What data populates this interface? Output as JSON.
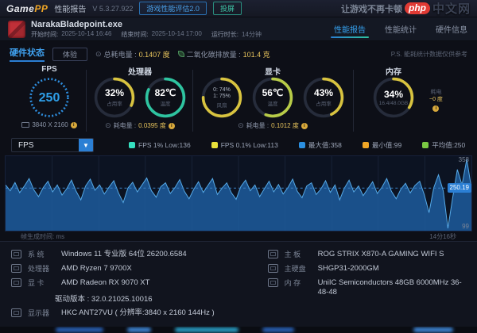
{
  "titlebar": {
    "logo_game": "Game",
    "logo_pp": "PP",
    "app_title": "性能报告",
    "version": "V 5.3.27.922",
    "eval_button": "游戏性能评估2.0",
    "cast_button": "投屏",
    "slogan": "让游戏不再卡顿",
    "watermark_php": "php",
    "watermark_cn": "中文网"
  },
  "session": {
    "exe_name": "NarakaBladepoint.exe",
    "start_label": "开始时间:",
    "start_time": "2025-10-14 16:46",
    "end_label": "结束时间:",
    "end_time": "2025-10-14 17:00",
    "duration_label": "运行时长:",
    "duration": "14分钟",
    "tabs": [
      {
        "label": "性能报告",
        "active": true
      },
      {
        "label": "性能统计",
        "active": false
      },
      {
        "label": "硬件信息",
        "active": false
      }
    ]
  },
  "hardware": {
    "section_title": "硬件状态",
    "mode_button": "体验",
    "total_power_label": "总耗电量 :",
    "total_power_value": "0.1407 度",
    "co2_label": "二氧化碳排放量 :",
    "co2_value": "101.4 克",
    "note": "P.S. 能耗统计数据仅供参考",
    "fps": {
      "title": "FPS",
      "value": "250",
      "resolution": "3840 X 2160"
    },
    "cpu": {
      "title": "处理器",
      "util_value": "32%",
      "util_label": "占用率",
      "temp_value": "82℃",
      "temp_label": "温度",
      "power_label": "耗电量 :",
      "power_value": "0.0395 度"
    },
    "gpu": {
      "title": "显卡",
      "fan_line1": "0: 74%",
      "fan_line2": "1: 75%",
      "fan_label": "风扇",
      "temp_value": "56℃",
      "temp_label": "温度",
      "util_value": "43%",
      "util_label": "占用率",
      "power_label": "耗电量 :",
      "power_value": "0.1012 度"
    },
    "mem": {
      "title": "内存",
      "util_value": "34%",
      "util_label": "16.4/48.0GB",
      "side_label": "耗电",
      "side_value": "~0 度"
    },
    "gauges": {
      "cpu_util": 32,
      "cpu_temp": 82,
      "gpu_fan": 75,
      "gpu_temp": 56,
      "gpu_util": 43,
      "mem_util": 34
    },
    "gauge_colors": {
      "yellow": "#d8c33f",
      "teal": "#2ec4a0",
      "green": "#b8cc48",
      "blue": "#2e8fe0"
    }
  },
  "chart": {
    "selector_value": "FPS"
  },
  "chart_data": {
    "type": "area",
    "title": "FPS over session",
    "series": [
      {
        "name": "FPS",
        "values": [
          262,
          240,
          271,
          233,
          258,
          286,
          244,
          218,
          252,
          276,
          236,
          262,
          224,
          248,
          280,
          238,
          206,
          258,
          284,
          242,
          262,
          228,
          254,
          278,
          232,
          196,
          250,
          272,
          236,
          262,
          288,
          240,
          216,
          256,
          270,
          230,
          252,
          282,
          238,
          210,
          246,
          274,
          234,
          260,
          286,
          226,
          250,
          270,
          232,
          208,
          256,
          280,
          240,
          262,
          218,
          248,
          276,
          236,
          264,
          228,
          252,
          284,
          238,
          214,
          258,
          270,
          226,
          246,
          278,
          234,
          262,
          206,
          250,
          280,
          236,
          258,
          222,
          248,
          274,
          230,
          254,
          286,
          238,
          210,
          246,
          268,
          232,
          260,
          276,
          224,
          158,
          252,
          300,
          240,
          99,
          212,
          320,
          262,
          358,
          250
        ]
      }
    ],
    "ylim": [
      90,
      370
    ],
    "grid": true,
    "legend_position": "top",
    "x_left_label": "帧生成时间: ms",
    "x_right_label": "14分16秒",
    "right_axis_labels": {
      "max": "358",
      "avg": "250.19",
      "min": "99"
    },
    "stats": {
      "fps_1pct_low": 136,
      "fps_01pct_low": 113,
      "max": 358,
      "min": 99,
      "avg": 250
    },
    "legend": [
      {
        "label": "FPS 1% Low:136",
        "color": "#35e0c0"
      },
      {
        "label": "FPS 0.1% Low:113",
        "color": "#e8e13a"
      },
      {
        "label": "最大值:358",
        "color": "#2b8fe0"
      },
      {
        "label": "最小值:99",
        "color": "#f0a626"
      },
      {
        "label": "平均值:250",
        "color": "#7ac943"
      }
    ]
  },
  "sysinfo": {
    "left": [
      {
        "icon": "windows-icon",
        "label": "系 统",
        "value": "Windows 11 专业版 64位 26200.6584"
      },
      {
        "icon": "cpu-icon",
        "label": "处理器",
        "value": "AMD Ryzen 7 9700X"
      },
      {
        "icon": "gpu-icon",
        "label": "显 卡",
        "value": "AMD Radeon RX 9070 XT",
        "value2": "驱动版本 : 32.0.21025.10016"
      },
      {
        "icon": "monitor-icon",
        "label": "显示器",
        "value": "HKC ANT27VU ( 分辨率:3840 x 2160 144Hz )"
      }
    ],
    "right": [
      {
        "icon": "motherboard-icon",
        "label": "主 板",
        "value": "ROG STRIX X870-A GAMING WIFI S"
      },
      {
        "icon": "disk-icon",
        "label": "主硬盘",
        "value": "SHGP31-2000GM"
      },
      {
        "icon": "ram-icon",
        "label": "内 存",
        "value": "UniIC Semiconductors 48GB 6000MHz 36-48-48"
      }
    ]
  }
}
